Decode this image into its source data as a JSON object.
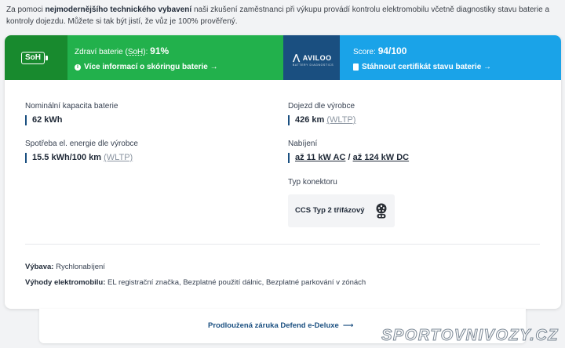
{
  "intro": {
    "part1": "Za pomoci ",
    "bold": "nejmodernějšího technického vybavení",
    "part2": " naši zkušení zaměstnanci při výkupu provádí kontrolu elektromobilu včetně diagnostiky stavu baterie a kontroly dojezdu. Můžete si tak být jistí, že vůz je 100% prověřený."
  },
  "banner": {
    "soh_badge": "SoH",
    "soh_prefix": "Zdraví baterie (",
    "soh_abbr": "SoH",
    "soh_suffix": "): ",
    "soh_value": "91%",
    "soh_link": "Více informací o skóringu baterie →",
    "aviloo_name": "AVILOO",
    "aviloo_sub": "BATTERY DIAGNOSTICS",
    "score_label": "Score: ",
    "score_value": "94/100",
    "cert_link": "Stáhnout certifikát stavu baterie →"
  },
  "specs": {
    "capacity_label": "Nominální kapacita baterie",
    "capacity_value": "62 kWh",
    "range_label": "Dojezd dle výrobce",
    "range_value": "426 km",
    "range_std": "(WLTP)",
    "consumption_label": "Spotřeba el. energie dle výrobce",
    "consumption_value": "15.5 kWh/100 km",
    "consumption_std": "(WLTP)",
    "charging_label": "Nabíjení",
    "charging_ac": "až 11 kW AC",
    "charging_sep": " / ",
    "charging_dc": "až 124 kW DC",
    "connector_label": "Typ konektoru",
    "connector_value": "CCS Typ 2 třífázový"
  },
  "features": {
    "equipment_label": "Výbava:",
    "equipment_value": " Rychlonabíjení",
    "benefits_label": "Výhody elektromobilu:",
    "benefits_value": " EL registrační značka, Bezplatné použití dálnic, Bezplatné parkování v zónách"
  },
  "warranty_link": "Prodloužená záruka Defend e-Deluxe",
  "watermark": "SPORTOVNIVOZY.CZ",
  "colors": {
    "green_dark": "#188a2e",
    "green": "#22b14c",
    "navy": "#1a4f80",
    "blue": "#1aa3e8"
  }
}
